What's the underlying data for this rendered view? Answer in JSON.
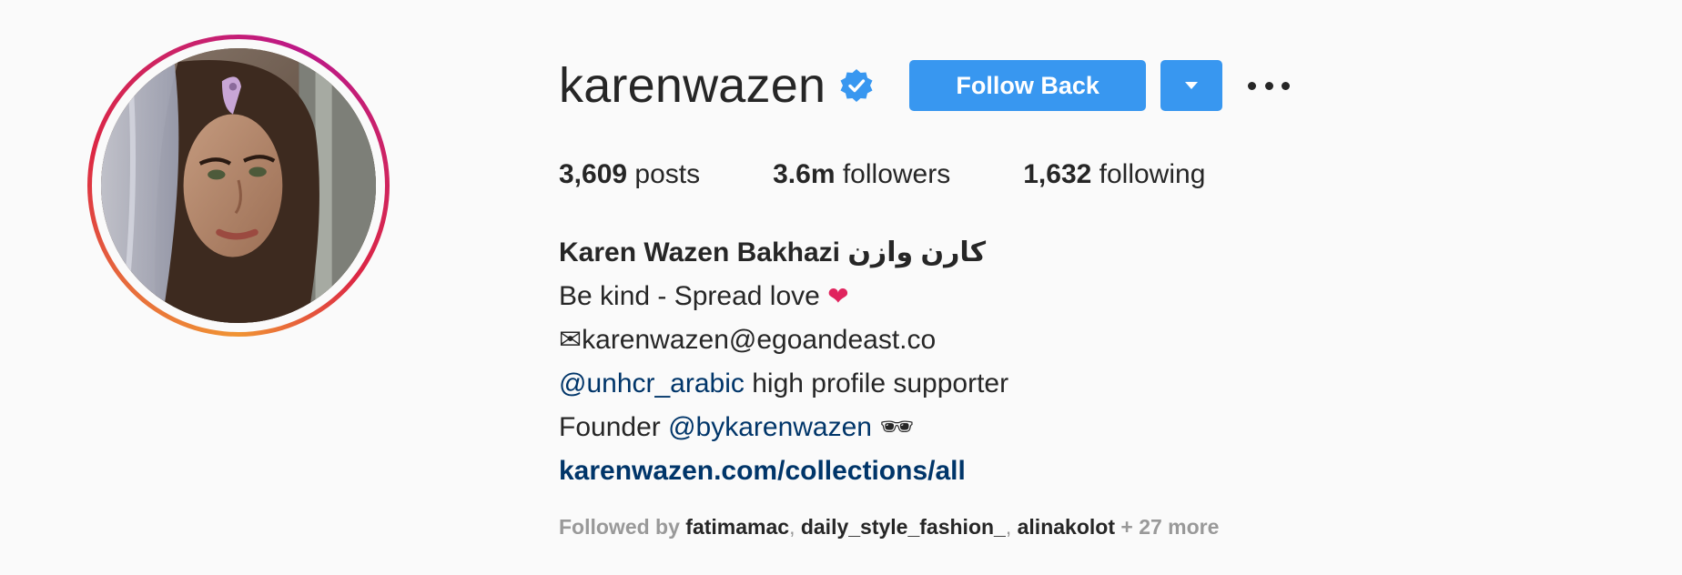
{
  "profile": {
    "username": "karenwazen",
    "verified": true,
    "follow_button_label": "Follow Back",
    "stats": {
      "posts_count": "3,609",
      "posts_label": " posts",
      "followers_count": "3.6m",
      "followers_label": " followers",
      "following_count": "1,632",
      "following_label": " following"
    },
    "bio": {
      "full_name": "Karen Wazen Bakhazi كارن وازن",
      "line1_text": "Be kind - Spread love ",
      "line1_emoji": "❤",
      "line2_text": "✉karenwazen@egoandeast.co",
      "line3_mention": "@unhcr_arabic",
      "line3_text": " high profile supporter",
      "line4_prefix": "Founder ",
      "line4_mention": "@bykarenwazen",
      "line4_emoji": " 🕶",
      "website": "karenwazen.com/collections/all"
    },
    "followed_by": {
      "label": "Followed by ",
      "users": [
        "fatimamac",
        "daily_style_fashion_",
        "alinakolot"
      ],
      "separator": ", ",
      "more": " + 27 more"
    }
  },
  "colors": {
    "accent": "#3897f0",
    "link": "#003569",
    "text": "#262626",
    "muted": "#999999",
    "background": "#fafafa"
  },
  "icons": {
    "verified": "verified-badge-icon",
    "dropdown": "chevron-down-icon",
    "more": "more-options-icon"
  }
}
